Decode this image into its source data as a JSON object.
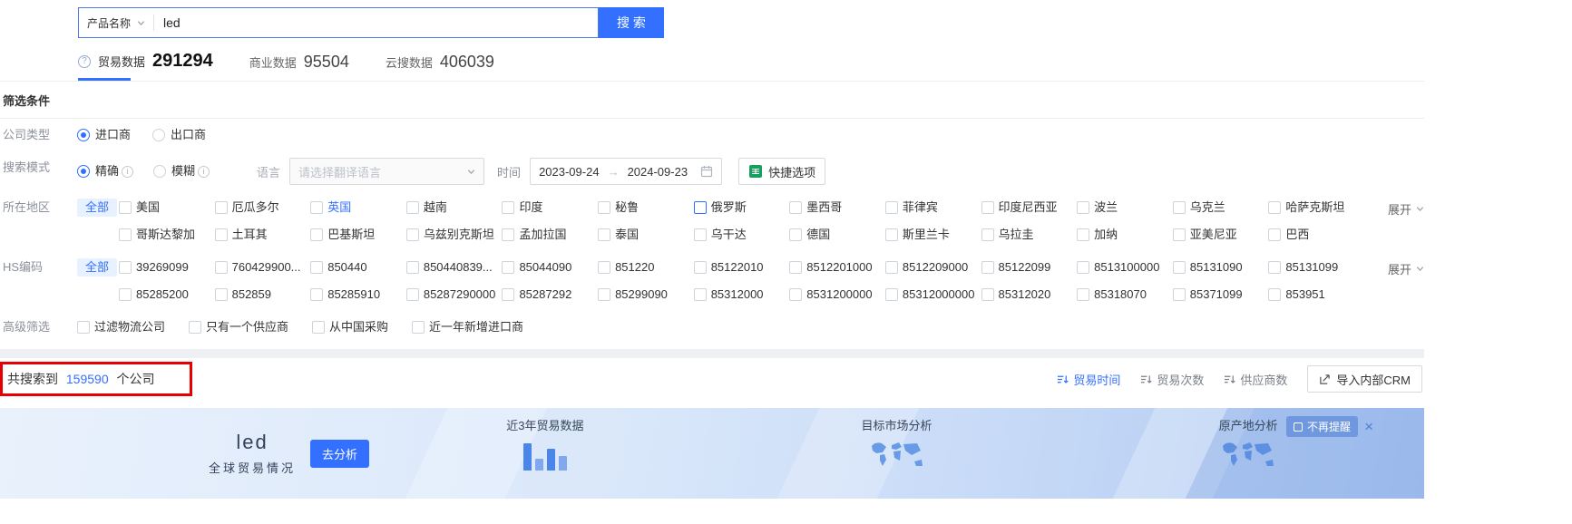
{
  "colors": {
    "accent": "#3370ff",
    "annotation_red": "#e80000",
    "excel_green": "#17a05d"
  },
  "search_bar": {
    "category": "产品名称",
    "query": "led",
    "button": "搜 索"
  },
  "tabs": [
    {
      "label": "贸易数据",
      "count": "291294"
    },
    {
      "label": "商业数据",
      "count": "95504"
    },
    {
      "label": "云搜数据",
      "count": "406039"
    }
  ],
  "filters": {
    "title": "筛选条件",
    "company_type": {
      "label": "公司类型",
      "options": [
        {
          "label": "进口商",
          "selected": true
        },
        {
          "label": "出口商",
          "selected": false
        }
      ]
    },
    "search_mode": {
      "label": "搜索模式",
      "options": [
        {
          "label": "精确",
          "selected": true
        },
        {
          "label": "模糊",
          "selected": false
        }
      ],
      "language_label": "语言",
      "language_placeholder": "请选择翻译语言",
      "time_label": "时间",
      "date_start": "2023-09-24",
      "date_separator": "→",
      "date_end": "2024-09-23",
      "quick_option": "快捷选项"
    },
    "region": {
      "label": "所在地区",
      "all": "全部",
      "expand": "展开",
      "row1": [
        "美国",
        "厄瓜多尔",
        {
          "label": "英国",
          "state": "text-active"
        },
        "越南",
        "印度",
        "秘鲁",
        {
          "label": "俄罗斯",
          "state": "box-active"
        },
        "墨西哥",
        "菲律宾",
        "印度尼西亚",
        "波兰",
        "乌克兰",
        "哈萨克斯坦"
      ],
      "row2": [
        "哥斯达黎加",
        "土耳其",
        "巴基斯坦",
        "乌兹别克斯坦",
        "孟加拉国",
        "泰国",
        "乌干达",
        "德国",
        "斯里兰卡",
        "乌拉圭",
        "加纳",
        "亚美尼亚",
        "巴西"
      ]
    },
    "hs_code": {
      "label": "HS编码",
      "all": "全部",
      "expand": "展开",
      "row1": [
        "39269099",
        "760429900...",
        "850440",
        "850440839...",
        "85044090",
        "851220",
        "85122010",
        "8512201000",
        "8512209000",
        "85122099",
        "8513100000",
        "85131090",
        "85131099"
      ],
      "row2": [
        "85285200",
        "852859",
        "85285910",
        "85287290000",
        "85287292",
        "85299090",
        "85312000",
        "8531200000",
        "85312000000",
        "85312020",
        "85318070",
        "85371099",
        "853951"
      ]
    },
    "advanced": {
      "label": "高级筛选",
      "options": [
        "过滤物流公司",
        "只有一个供应商",
        "从中国采购",
        "近一年新增进口商"
      ]
    }
  },
  "results": {
    "prefix": "共搜索到",
    "count": "159590",
    "suffix": "个公司",
    "sorts": [
      {
        "label": "贸易时间",
        "state": "active"
      },
      {
        "label": "贸易次数"
      },
      {
        "label": "供应商数"
      }
    ],
    "crm_button": "导入内部CRM"
  },
  "banner": {
    "keyword": "led",
    "subtitle": "全球贸易情况",
    "analyze_button": "去分析",
    "features": [
      "近3年贸易数据",
      "目标市场分析",
      "原产地分析"
    ],
    "dismiss": "不再提醒",
    "close": "×"
  }
}
